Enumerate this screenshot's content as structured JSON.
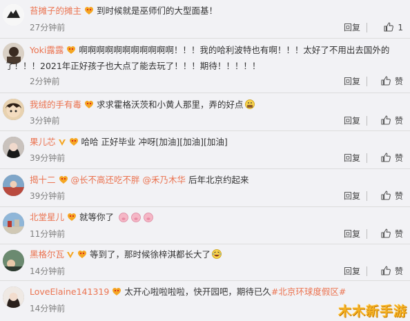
{
  "actions": {
    "reply": "回复",
    "like": "赞"
  },
  "comments": [
    {
      "name": "苔摊子的摊主",
      "text": "到时候就是巫师们的大型面基！",
      "time": "27分钟前",
      "likes": "1"
    },
    {
      "name": "Yoki露露",
      "text": "啊啊啊啊啊啊啊啊啊啊啊！！！我的哈利波特也有啊！！！太好了不用出去国外的",
      "text2": "了！！！2021年正好孩子也大点了能去玩了！！！期待！！！！！",
      "time": "2分钟前",
      "likes": ""
    },
    {
      "name": "我绒的手有毒",
      "text": "求求霍格沃茨和小黄人那里，弄的好点",
      "time": "3分钟前",
      "likes": ""
    },
    {
      "name": "果儿芯",
      "text": "哈哈 正好毕业 冲呀[加油][加油][加油]",
      "time": "39分钟前",
      "likes": ""
    },
    {
      "name": "揭十二",
      "mention1": "@长不高还吃不胖",
      "mention2": "@禾乃木华",
      "text": "后年北京约起来",
      "time": "39分钟前",
      "likes": ""
    },
    {
      "name": "北堂星儿",
      "text": "就等你了",
      "time": "11分钟前",
      "likes": ""
    },
    {
      "name": "黑格尔瓦",
      "text": "等到了，那时候徐梓淇都长大了",
      "time": "14分钟前",
      "likes": ""
    },
    {
      "name": "LoveElaine141319",
      "text": "太开心啦啦啦啦，快开园吧，期待已久",
      "hashtag": "#北京环球度假区#",
      "time": "14分钟前",
      "likes": ""
    }
  ],
  "watermark": "木木新手游",
  "colors": {
    "name": "#eb7350",
    "time": "#808080",
    "background": "#f2f2f5"
  }
}
